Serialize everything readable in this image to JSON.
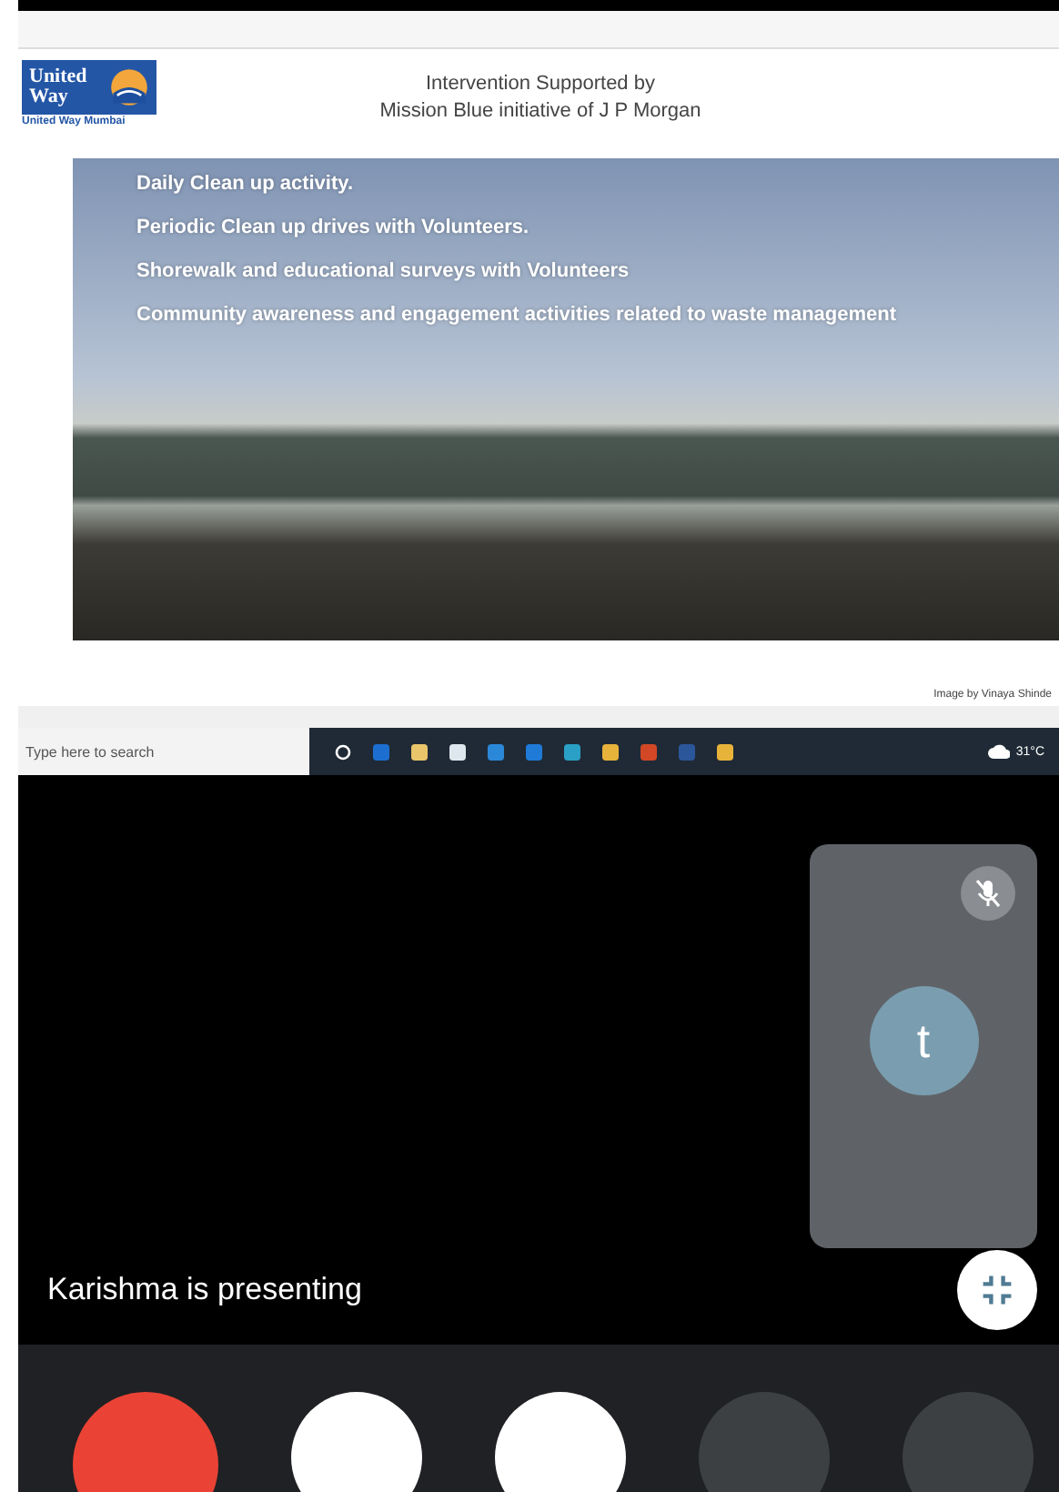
{
  "shared_screen": {
    "slide": {
      "logo": {
        "lines": [
          "United",
          "Way"
        ],
        "caption": "United Way Mumbai"
      },
      "title_lines": [
        "Intervention Supported by",
        "Mission Blue initiative of J P Morgan"
      ],
      "bullets": [
        "Daily Clean up  activity.",
        "Periodic Clean up drives with Volunteers.",
        "Shorewalk and educational surveys with Volunteers",
        "Community awareness and engagement activities related to waste management"
      ],
      "credit": "Image by Vinaya Shinde"
    },
    "taskbar": {
      "search": {
        "placeholder": "Type here to search"
      },
      "temperature": "31°C"
    }
  },
  "participant_tile": {
    "initial": "t",
    "muted": true
  },
  "presenter_banner": "Karishma is presenting"
}
